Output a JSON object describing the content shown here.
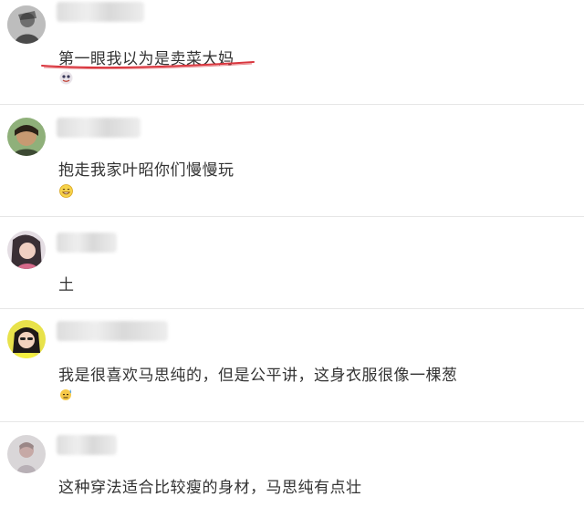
{
  "comments": [
    {
      "text": "第一眼我以为是卖菜大妈",
      "avatar_icon": "avatar-person-icon",
      "emoji_icon": "sticker-emoji-icon"
    },
    {
      "text": "抱走我家叶昭你们慢慢玩",
      "avatar_icon": "avatar-person-icon",
      "emoji_icon": "smile-emoji-icon"
    },
    {
      "text": "土",
      "avatar_icon": "avatar-person-icon",
      "emoji_icon": ""
    },
    {
      "text": "我是很喜欢马思纯的，但是公平讲，这身衣服很像一棵葱",
      "avatar_icon": "avatar-person-icon",
      "emoji_icon": "sweat-emoji-icon"
    },
    {
      "text": "这种穿法适合比较瘦的身材，马思纯有点壮",
      "avatar_icon": "avatar-person-icon",
      "emoji_icon": ""
    }
  ],
  "colors": {
    "annotation_underline": "#d9363e",
    "divider": "#e6e6e6",
    "text": "#333333"
  }
}
